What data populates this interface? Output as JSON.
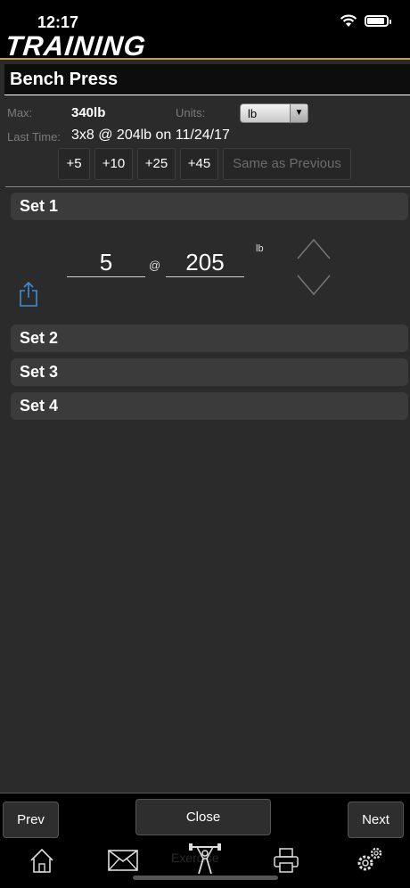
{
  "status": {
    "time": "12:17"
  },
  "app": {
    "title": "TRAINING"
  },
  "exercise": {
    "name": "Bench Press",
    "max_label": "Max:",
    "max_value": "340lb",
    "units_label": "Units:",
    "units_value": "lb",
    "last_label": "Last Time:",
    "last_value": "3x8 @ 204lb on 11/24/17"
  },
  "increments": [
    "+5",
    "+10",
    "+25",
    "+45"
  ],
  "same_as_previous": "Same as Previous",
  "sets": [
    {
      "label": "Set 1",
      "reps": "5",
      "weight": "205",
      "unit": "lb"
    },
    {
      "label": "Set 2"
    },
    {
      "label": "Set 3"
    },
    {
      "label": "Set 4"
    }
  ],
  "separator": "@",
  "footer": {
    "prev": "Prev",
    "close": "Close",
    "next": "Next",
    "background_text": "Exercise"
  },
  "tab_icons": [
    "home-icon",
    "mail-icon",
    "weightlifter-icon",
    "printer-icon",
    "settings-icon"
  ]
}
